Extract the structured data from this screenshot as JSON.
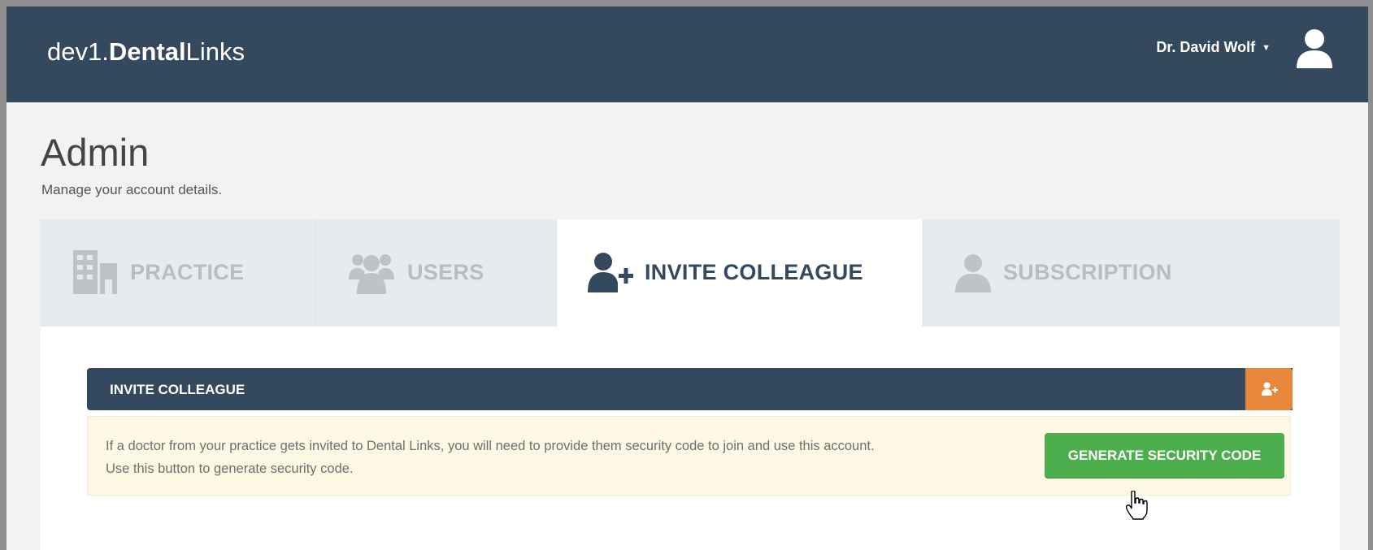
{
  "header": {
    "brand_prefix": "dev1.",
    "brand_bold": "Dental",
    "brand_suffix": "Links",
    "user_name": "Dr. David Wolf",
    "caret_icon": "caret-down",
    "avatar_icon": "user-icon"
  },
  "page": {
    "title": "Admin",
    "subtitle": "Manage your account details."
  },
  "tabs": [
    {
      "label": "PRACTICE",
      "icon": "building-icon",
      "active": false
    },
    {
      "label": "USERS",
      "icon": "users-icon",
      "active": false
    },
    {
      "label": "INVITE COLLEAGUE",
      "icon": "user-plus-icon",
      "active": true
    },
    {
      "label": "SUBSCRIPTION",
      "icon": "user-icon",
      "active": false
    }
  ],
  "section": {
    "title": "INVITE COLLEAGUE",
    "action_icon": "user-plus-icon"
  },
  "notice": {
    "line1": "If a doctor from your practice gets invited to Dental Links, you will need to provide them security code to join and use this account.",
    "line2": "Use this button to generate security code.",
    "button_label": "GENERATE SECURITY CODE"
  },
  "colors": {
    "navy": "#34495e",
    "orange": "#e8873a",
    "green": "#4cae4c",
    "notice_bg": "#fcf8e3"
  }
}
